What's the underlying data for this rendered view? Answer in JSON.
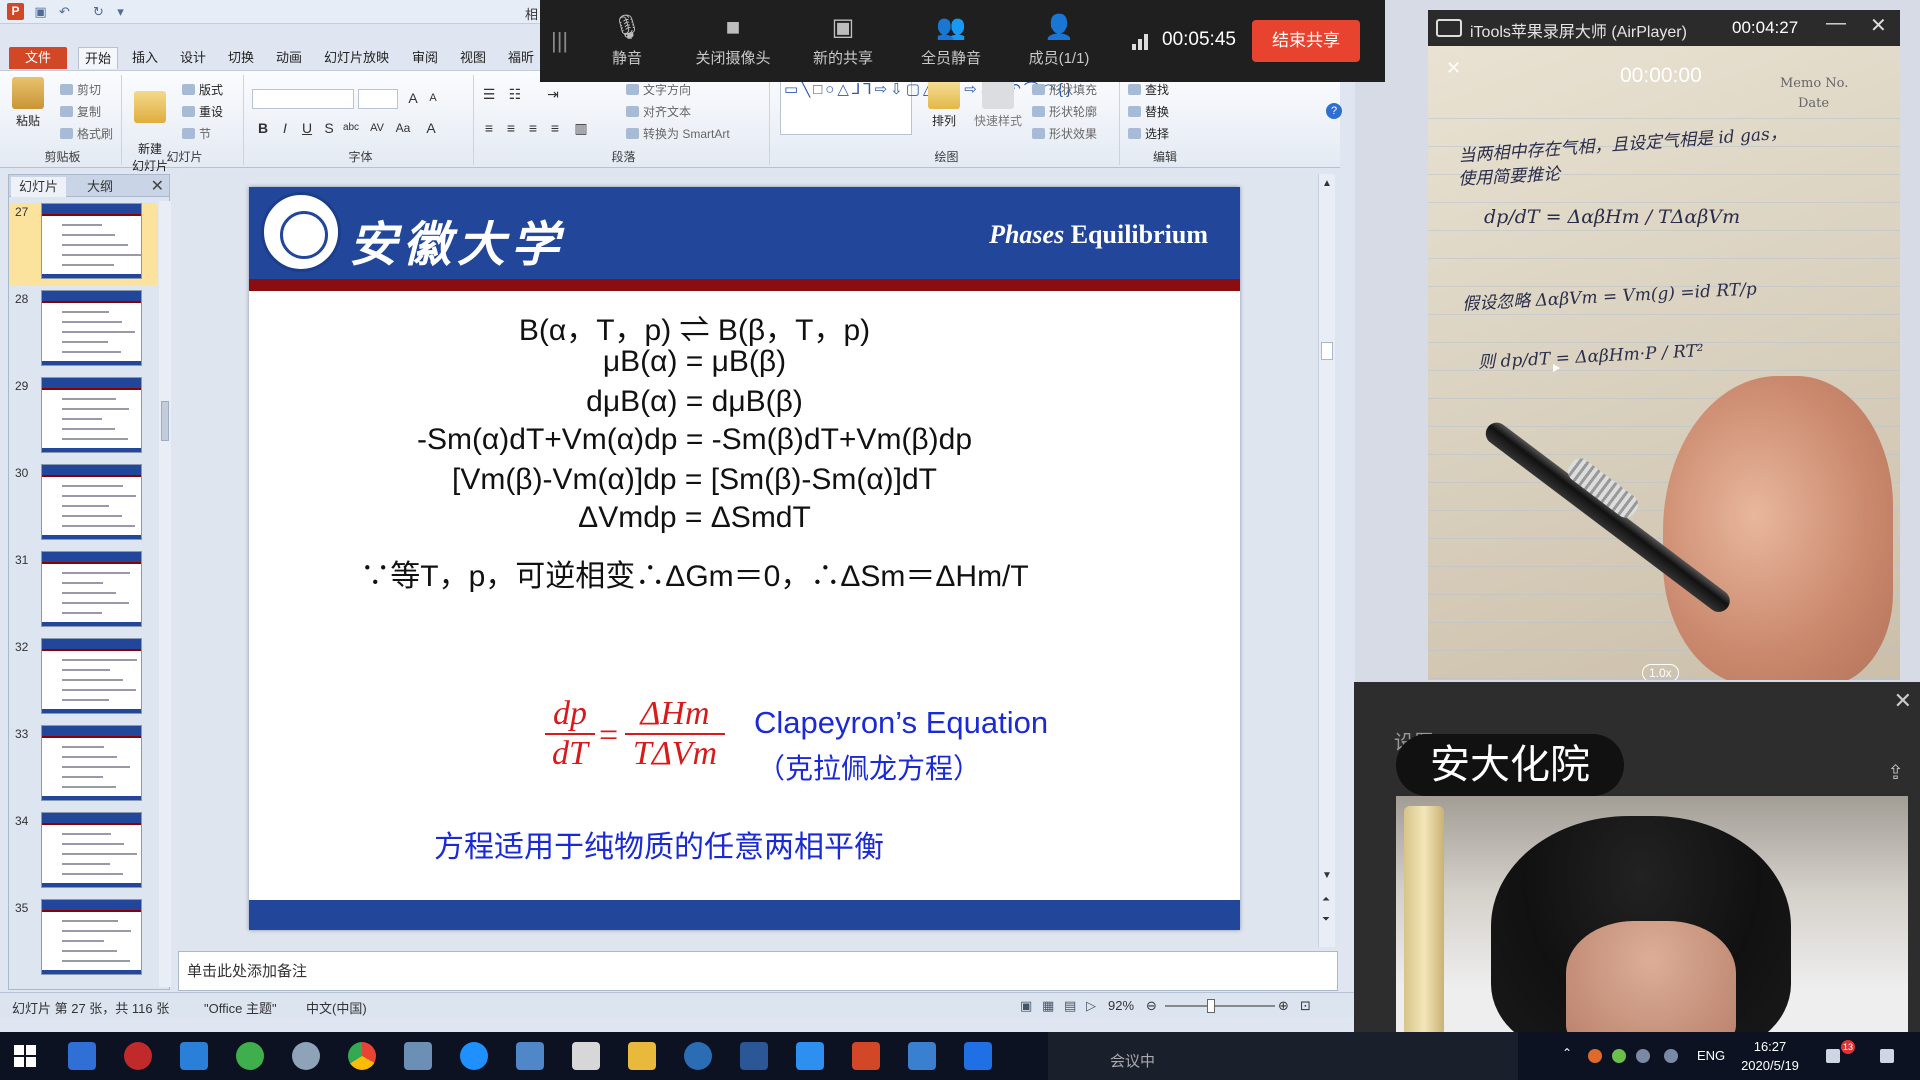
{
  "ppt": {
    "doc_title": "相",
    "tabs": [
      "文件",
      "开始",
      "插入",
      "设计",
      "切换",
      "动画",
      "幻灯片放映",
      "审阅",
      "视图",
      "福昕"
    ],
    "ribbon": {
      "clipboard": {
        "label": "剪贴板",
        "paste": "粘贴",
        "cut": "剪切",
        "copy": "复制",
        "format_painter": "格式刷"
      },
      "slides": {
        "label": "幻灯片",
        "new_slide": "新建\n幻灯片",
        "layout": "版式",
        "reset": "重设",
        "section": "节"
      },
      "font": {
        "label": "字体"
      },
      "paragraph": {
        "label": "段落",
        "text_direction": "文字方向",
        "align_text": "对齐文本",
        "smartart": "转换为 SmartArt"
      },
      "drawing": {
        "label": "绘图",
        "arrange": "排列",
        "quick_styles": "快速样式",
        "shape_fill": "形状填充",
        "shape_outline": "形状轮廓",
        "shape_effects": "形状效果"
      },
      "editing": {
        "label": "编辑",
        "find": "查找",
        "replace": "替换",
        "select": "选择"
      }
    },
    "left_panel": {
      "tab_slides": "幻灯片",
      "tab_outline": "大纲",
      "slide_numbers": [
        "27",
        "28",
        "29",
        "30",
        "31",
        "32",
        "33",
        "34",
        "35"
      ]
    },
    "slide": {
      "univ_name": "安徽大学",
      "title_italic": "Phases",
      "title_rest": " Equilibrium",
      "lines": [
        "B(α，T，p) ⇌ B(β，T，p)",
        "μB(α) = μB(β)",
        "dμB(α) = dμB(β)",
        "-Sm(α)dT+Vm(α)dp = -Sm(β)dT+Vm(β)dp",
        "[Vm(β)-Vm(α)]dp = [Sm(β)-Sm(α)]dT",
        "ΔVmdp = ΔSmdT",
        "∵等T，p，可逆相变∴ΔGm＝0，∴ΔSm＝ΔHm/T"
      ],
      "frac_left_num": "dp",
      "frac_left_den": "dT",
      "frac_right_num": "ΔHm",
      "frac_right_den": "TΔVm",
      "equation_name": "Clapeyron’s Equation",
      "equation_name_zh": "（克拉佩龙方程）",
      "applicability": "方程适用于纯物质的任意两相平衡"
    },
    "notes_placeholder": "单击此处添加备注",
    "status": {
      "slide_info": "幻灯片 第 27 张，共 116 张",
      "theme": "\"Office 主题\"",
      "language": "中文(中国)",
      "zoom": "92%"
    }
  },
  "meeting": {
    "buttons": [
      "静音",
      "关闭摄像头",
      "新的共享",
      "全员静音",
      "成员(1/1)"
    ],
    "timer": "00:05:45",
    "end_share": "结束共享",
    "taskbar_status": "会议中"
  },
  "airplayer": {
    "title": "iTools苹果录屏大师 (AirPlayer)",
    "timer": "00:04:27",
    "record_timer": "00:00:00",
    "memo_no": "Memo No.",
    "memo_date": "Date",
    "speed": "1.0x",
    "handwriting": [
      "当两相中存在气相，且设定气相是 id gas，",
      "使用简要推论",
      "dp/dT = ΔαβHm / TΔαβVm",
      "假设忽略 ΔαβVm = Vm(g) =id RT/p",
      "则 dp/dT = ΔαβHm·P / RT²"
    ]
  },
  "camera": {
    "settings": "设置",
    "label": "安大化院"
  },
  "taskbar": {
    "lang": "ENG",
    "time": "16:27",
    "date": "2020/5/19",
    "badge": "13"
  },
  "colors": {
    "slide_blue": "#21469a",
    "slide_red": "#8b0d12",
    "formula_red": "#d81a1a",
    "text_blue": "#1a2bd6",
    "end_share": "#e8432f",
    "file_tab": "#d24726"
  }
}
